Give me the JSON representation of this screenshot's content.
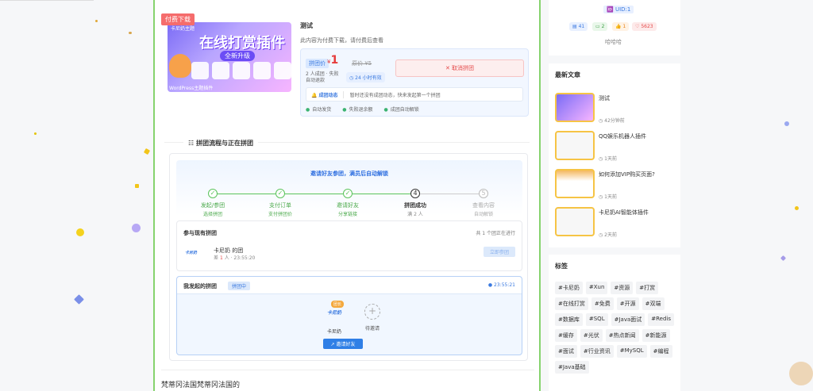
{
  "product": {
    "badge": "付费下载",
    "cover": {
      "small": "卡尼奶主题",
      "title": "在线打赏插件",
      "subtitle": "全新升级",
      "foot": "WordPress主题插件"
    },
    "title": "测试",
    "description": "此内容为付费下载，请付费后查看",
    "group_tag": "拼团价",
    "price_symbol": "¥",
    "price": "1",
    "original_price": "原价 ¥5",
    "cancel_button": "✕ 取消拼团",
    "group_info": "2 人成团 · 失败",
    "refund_info": "自动退款",
    "valid": "◷ 24 小时有效",
    "dynamic_label": "🔔 成团动态",
    "dynamic_text": "暂时还没有成团动态，快来发起第一个拼团",
    "features": [
      "自动发货",
      "失败退余额",
      "成团自动解锁"
    ]
  },
  "flow": {
    "section_title": "☷ 拼团流程与正在拼团",
    "steps_heading": "邀请好友参团，满员后自动解锁",
    "steps": [
      {
        "icon": "✓",
        "name": "发起/参团",
        "sub": "选择拼团"
      },
      {
        "icon": "✓",
        "name": "支付订单",
        "sub": "支付拼团价"
      },
      {
        "icon": "✓",
        "name": "邀请好友",
        "sub": "分享链接"
      },
      {
        "icon": "4",
        "name": "拼团成功",
        "sub": "满 2 人"
      },
      {
        "icon": "5",
        "name": "查看内容",
        "sub": "自动解锁"
      }
    ],
    "join": {
      "title": "参与现有拼团",
      "count": "共 1 个团正在进行",
      "logo": "卡尼奶",
      "name": "卡尼奶 的团",
      "meta_prefix": "差",
      "meta_num": "1",
      "meta_suffix": "人 · 23:55:20",
      "button": "立即参团"
    },
    "mine": {
      "title": "我发起的拼团",
      "tag": "拼团中",
      "time": "● 23:55:21",
      "leader_badge": "团长",
      "leader_logo": "卡尼奶",
      "leader_name": "卡尼奶",
      "wait_icon": "+",
      "wait_label": "待邀请",
      "invite_button": "↗ 邀请好友"
    }
  },
  "bottom_text": "梵蒂冈法国梵蒂冈法国的",
  "sidebar": {
    "uid": "🆔 UID:1",
    "stats": [
      {
        "icon": "▤",
        "value": "41"
      },
      {
        "icon": "▭",
        "value": "2"
      },
      {
        "icon": "👍",
        "value": "1"
      },
      {
        "icon": "♡",
        "value": "5623"
      }
    ],
    "signature": "哈哈哈",
    "latest_title": "最新文章",
    "articles": [
      {
        "title": "测试",
        "time": "◷ 42分钟前"
      },
      {
        "title": "QQ娱乐机器人插件",
        "time": "◷ 1天前"
      },
      {
        "title": "如何添加VIP购买页面?",
        "time": "◷ 1天前"
      },
      {
        "title": "卡尼奶AI智能体插件",
        "time": "◷ 2天前"
      }
    ],
    "tags_title": "标签",
    "tags": [
      "#卡尼奶",
      "#Xun",
      "#资源",
      "#打赏",
      "#在线打赏",
      "#免费",
      "#开源",
      "#双端",
      "#数据库",
      "#SQL",
      "#Java面试",
      "#Redis",
      "#缓存",
      "#光伏",
      "#热点新闻",
      "#新能源",
      "#面试",
      "#行业资讯",
      "#MySQL",
      "#编程",
      "#Java基础"
    ]
  }
}
